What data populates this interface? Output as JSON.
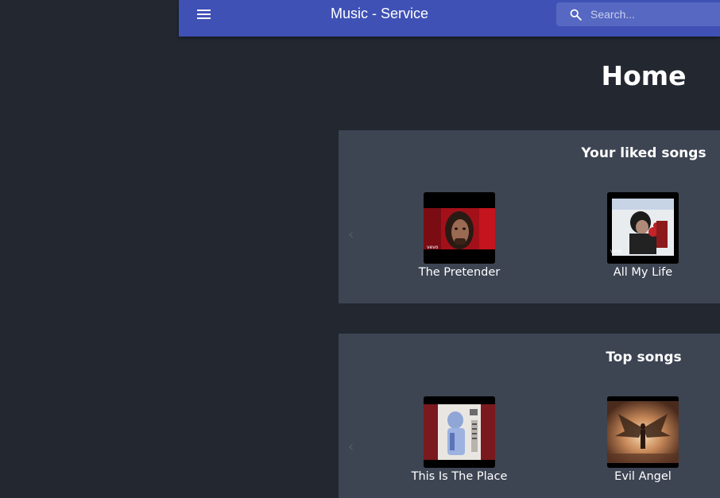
{
  "appbar": {
    "title": "Music - Service",
    "search_placeholder": "Search...",
    "color": "#3f51b5"
  },
  "page": {
    "title": "Home"
  },
  "sections": {
    "liked": {
      "title": "Your liked songs",
      "songs": [
        {
          "title": "The Pretender",
          "thumb": "performer-closeup-red-background"
        },
        {
          "title": "All My Life",
          "thumb": "singer-at-microphone"
        }
      ]
    },
    "top": {
      "title": "Top songs",
      "songs": [
        {
          "title": "This Is The Place",
          "thumb": "album-art-blue-figure-on-red"
        },
        {
          "title": "Evil Angel",
          "thumb": "winged-figure-warm-light"
        }
      ]
    }
  },
  "icons": {
    "menu": "hamburger-menu-icon",
    "search": "search-icon",
    "prev": "chevron-left-icon"
  }
}
